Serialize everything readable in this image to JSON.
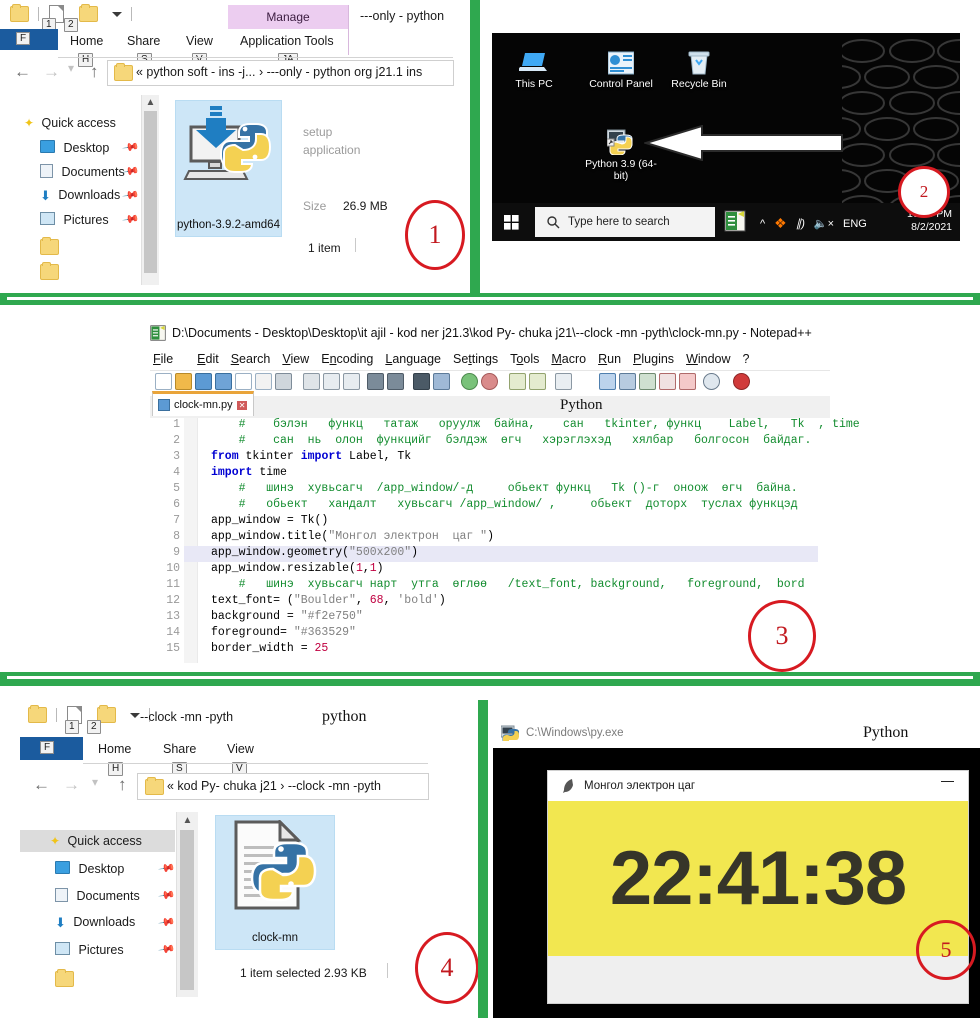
{
  "layout": {
    "accent_green": "#2fa84f",
    "marker_red": "#d71a21"
  },
  "panel1_explorer": {
    "qat": {
      "folder_icon": "folder-icon",
      "new_folder_icon": "new-folder-icon",
      "properties_icon": "properties-icon",
      "dropdown_icon": "chevron-down-icon",
      "keytip_1": "1",
      "keytip_2": "2"
    },
    "window_title": "---only -  python",
    "contextual_tab_band": "Manage",
    "contextual_tab_label": "Application Tools",
    "contextual_tab_keytip": "JA",
    "ribbon_tabs": [
      {
        "label": "File",
        "short": "F",
        "keytip": ""
      },
      {
        "label": "Home",
        "keytip": "H"
      },
      {
        "label": "Share",
        "keytip": "S"
      },
      {
        "label": "View",
        "keytip": "V"
      }
    ],
    "nav": {
      "back": "←",
      "forward": "→",
      "recent": "⌄",
      "up": "↑"
    },
    "breadcrumb": "«  python soft - ins -j...  ›   ---only  -  python org j21.1 ins",
    "quick_access_label": "Quick access",
    "nav_items": [
      {
        "label": "Desktop",
        "icon": "desktop-icon",
        "pinned": true
      },
      {
        "label": "Documents",
        "icon": "documents-icon",
        "pinned": true
      },
      {
        "label": "Downloads",
        "icon": "downloads-icon",
        "pinned": true
      },
      {
        "label": "Pictures",
        "icon": "pictures-icon",
        "pinned": true
      },
      {
        "label": "",
        "icon": "folder-icon",
        "pinned": false
      },
      {
        "label": "",
        "icon": "folder-icon",
        "pinned": false
      }
    ],
    "file_tile": {
      "name": "python-3.9.2-amd64",
      "icon": "python-installer-icon",
      "selected": true
    },
    "details": {
      "type_line1": "setup",
      "type_line2": "application",
      "size_label": "Size",
      "size_value": "26.9 MB"
    },
    "status": "1 item",
    "marker": "1"
  },
  "panel2_desktop": {
    "icons": [
      {
        "label": "This PC",
        "icon": "this-pc-icon"
      },
      {
        "label": "Control Panel",
        "icon": "control-panel-icon"
      },
      {
        "label": "Recycle Bin",
        "icon": "recycle-bin-icon"
      },
      {
        "label": "Python 3.9 (64-bit)",
        "icon": "python-shortcut-icon"
      }
    ],
    "annotation_arrow": "left-pointing-arrow",
    "taskbar": {
      "start_icon": "windows-start-icon",
      "search_icon": "search-icon",
      "search_placeholder": "Type here to search",
      "pinned_app_icon": "notepadpp-icon",
      "tray_expand_icon": "chevron-up-icon",
      "antivirus_icon": "avast-icon",
      "network_icon": "wifi-icon",
      "volume_icon": "volume-muted-icon",
      "language": "ENG",
      "time": "10:23 PM",
      "date": "8/2/2021"
    },
    "marker": "2"
  },
  "panel3_notepadpp": {
    "app_icon": "notepadpp-icon",
    "title": "D:\\Documents - Desktop\\Desktop\\it ajil - kod ner j21.3\\kod Py- chuka j21\\--clock -mn -pyth\\clock-mn.py - Notepad++",
    "menu": [
      "File",
      "Edit",
      "Search",
      "View",
      "Encoding",
      "Language",
      "Settings",
      "Tools",
      "Macro",
      "Run",
      "Plugins",
      "Window",
      "?"
    ],
    "tab": {
      "label": "clock-mn.py",
      "save_icon": "save-icon",
      "close_icon": "close-icon"
    },
    "language_label": "Python",
    "code_lines": [
      {
        "n": "1",
        "tokens": [
          {
            "t": "com",
            "v": "    #    бэлэн   функц   татаж   оруулж  байна,    сан   tkinter, функц    Label,   Tk  , time"
          }
        ]
      },
      {
        "n": "2",
        "tokens": [
          {
            "t": "com",
            "v": "    #    сан  нь  олон  функцийг  бэлдэж  өгч   хэрэглэхэд   хялбар   болгосон  байдаг."
          }
        ]
      },
      {
        "n": "3",
        "tokens": [
          {
            "t": "kw",
            "v": "from"
          },
          {
            "t": "pl",
            "v": " tkinter "
          },
          {
            "t": "kw",
            "v": "import"
          },
          {
            "t": "pl",
            "v": " Label, Tk"
          }
        ]
      },
      {
        "n": "4",
        "tokens": [
          {
            "t": "kw",
            "v": "import"
          },
          {
            "t": "pl",
            "v": " time"
          }
        ]
      },
      {
        "n": "5",
        "tokens": [
          {
            "t": "com",
            "v": "    #   шинэ  хувьсагч  /app_window/-д     обьект функц   Tk ()-г  оноож  өгч  байна."
          }
        ]
      },
      {
        "n": "6",
        "tokens": [
          {
            "t": "com",
            "v": "    #   обьект   хандалт   хувьсагч /app_window/ ,     обьект  доторх  туслах функцэд"
          }
        ]
      },
      {
        "n": "7",
        "tokens": [
          {
            "t": "pl",
            "v": "app_window = Tk()"
          }
        ]
      },
      {
        "n": "8",
        "tokens": [
          {
            "t": "pl",
            "v": "app_window.title("
          },
          {
            "t": "str",
            "v": "\"Монгол электрон  цаг \""
          },
          {
            "t": "pl",
            "v": ")"
          }
        ]
      },
      {
        "n": "9",
        "tokens": [
          {
            "t": "pl",
            "v": "app_window.geometry("
          },
          {
            "t": "str",
            "v": "\"500x200\""
          },
          {
            "t": "pl",
            "v": ")"
          }
        ],
        "highlight": true
      },
      {
        "n": "10",
        "tokens": [
          {
            "t": "pl",
            "v": "app_window.resizable("
          },
          {
            "t": "num",
            "v": "1"
          },
          {
            "t": "pl",
            "v": ","
          },
          {
            "t": "num",
            "v": "1"
          },
          {
            "t": "pl",
            "v": ")"
          }
        ]
      },
      {
        "n": "11",
        "tokens": [
          {
            "t": "com",
            "v": "    #   шинэ  хувьсагч нарт  утга  өглөө   /text_font, background,   foreground,  bord"
          }
        ]
      },
      {
        "n": "12",
        "tokens": [
          {
            "t": "pl",
            "v": "text_font= ("
          },
          {
            "t": "str",
            "v": "\"Boulder\""
          },
          {
            "t": "pl",
            "v": ", "
          },
          {
            "t": "num",
            "v": "68"
          },
          {
            "t": "pl",
            "v": ", "
          },
          {
            "t": "str",
            "v": "'bold'"
          },
          {
            "t": "pl",
            "v": ")"
          }
        ]
      },
      {
        "n": "13",
        "tokens": [
          {
            "t": "pl",
            "v": "background = "
          },
          {
            "t": "str",
            "v": "\"#f2e750\""
          }
        ]
      },
      {
        "n": "14",
        "tokens": [
          {
            "t": "pl",
            "v": "foreground= "
          },
          {
            "t": "str",
            "v": "\"#363529\""
          }
        ]
      },
      {
        "n": "15",
        "tokens": [
          {
            "t": "pl",
            "v": "border_width = "
          },
          {
            "t": "num",
            "v": "25"
          }
        ]
      }
    ],
    "marker": "3"
  },
  "panel4_explorer": {
    "qat": {
      "keytip_1": "1",
      "keytip_2": "2"
    },
    "window_title": "--clock -mn -pyth",
    "language_label": "python",
    "ribbon_tabs": [
      {
        "label": "File",
        "short": "F",
        "keytip": ""
      },
      {
        "label": "Home",
        "keytip": "H"
      },
      {
        "label": "Share",
        "keytip": "S"
      },
      {
        "label": "View",
        "keytip": "V"
      }
    ],
    "breadcrumb": "«  kod Py- chuka j21   ›   --clock -mn -pyth",
    "quick_access_label": "Quick access",
    "nav_items": [
      {
        "label": "Desktop",
        "icon": "desktop-icon",
        "pinned": true
      },
      {
        "label": "Documents",
        "icon": "documents-icon",
        "pinned": true
      },
      {
        "label": "Downloads",
        "icon": "downloads-icon",
        "pinned": true
      },
      {
        "label": "Pictures",
        "icon": "pictures-icon",
        "pinned": true
      },
      {
        "label": "",
        "icon": "folder-icon",
        "pinned": false
      }
    ],
    "file_tile": {
      "name": "clock-mn",
      "icon": "python-file-icon",
      "selected": true
    },
    "status": "1 item selected  2.93 KB",
    "marker": "4"
  },
  "panel5_clock": {
    "console_icon": "py-exe-icon",
    "console_path": "C:\\Windows\\py.exe",
    "console_language_label": "Python",
    "window": {
      "icon": "tk-feather-icon",
      "title": "Монгол электрон  цаг",
      "minimize_icon": "minimize-icon",
      "time": "22:41:38",
      "background": "#f2e750",
      "foreground": "#363529"
    },
    "marker": "5"
  }
}
